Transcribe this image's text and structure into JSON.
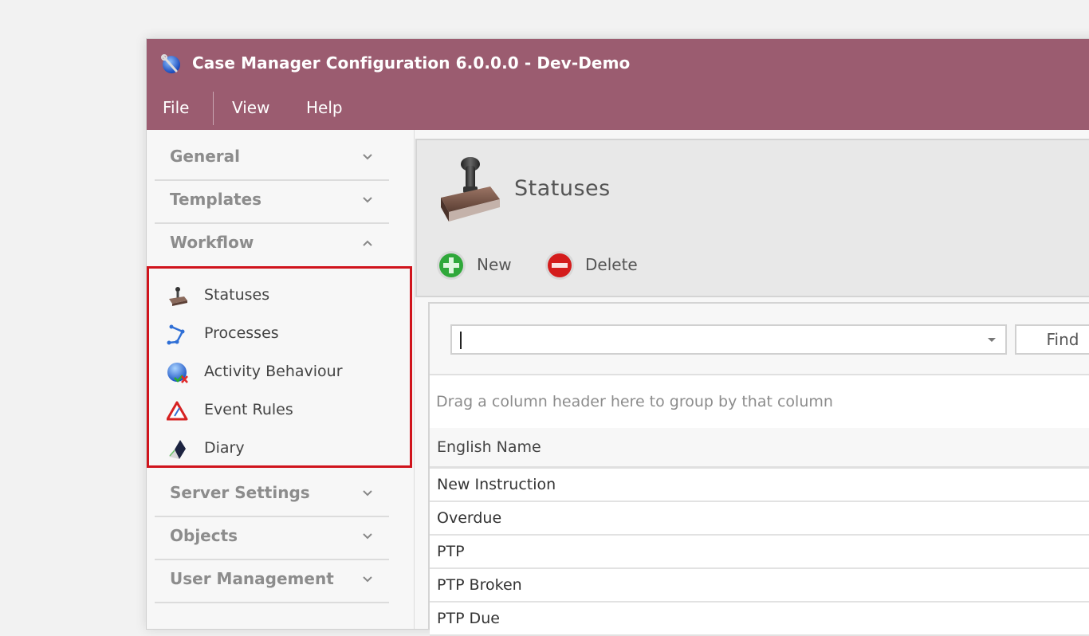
{
  "window": {
    "title": "Case Manager Configuration 6.0.0.0 - Dev-Demo",
    "accent_color": "#9b5c70",
    "highlight_color": "#d0141c"
  },
  "menu": {
    "items": [
      {
        "label": "File"
      },
      {
        "label": "View"
      },
      {
        "label": "Help"
      }
    ]
  },
  "sidebar": {
    "groups_top": [
      {
        "label": "General",
        "state": "collapsed",
        "icon": "chevron-down-icon"
      },
      {
        "label": "Templates",
        "state": "collapsed",
        "icon": "chevron-down-icon"
      },
      {
        "label": "Workflow",
        "state": "expanded",
        "icon": "chevron-up-icon"
      }
    ],
    "workflow_items": [
      {
        "label": "Statuses",
        "icon": "stamp-icon"
      },
      {
        "label": "Processes",
        "icon": "process-nodes-icon"
      },
      {
        "label": "Activity Behaviour",
        "icon": "globe-check-icon"
      },
      {
        "label": "Event Rules",
        "icon": "warning-triangle-icon"
      },
      {
        "label": "Diary",
        "icon": "diary-prism-icon"
      }
    ],
    "groups_bottom": [
      {
        "label": "Server Settings",
        "state": "collapsed",
        "icon": "chevron-down-icon"
      },
      {
        "label": "Objects",
        "state": "collapsed",
        "icon": "chevron-down-icon"
      },
      {
        "label": "User Management",
        "state": "collapsed",
        "icon": "chevron-down-icon"
      }
    ]
  },
  "content": {
    "header_title": "Statuses",
    "toolbar": {
      "new_label": "New",
      "delete_label": "Delete"
    },
    "search": {
      "value": "",
      "find_label": "Find"
    },
    "group_hint": "Drag a column header here to group by that column",
    "table": {
      "columns": [
        "English Name"
      ],
      "rows": [
        [
          "New Instruction"
        ],
        [
          "Overdue"
        ],
        [
          "PTP"
        ],
        [
          "PTP Broken"
        ],
        [
          "PTP Due"
        ]
      ]
    }
  }
}
